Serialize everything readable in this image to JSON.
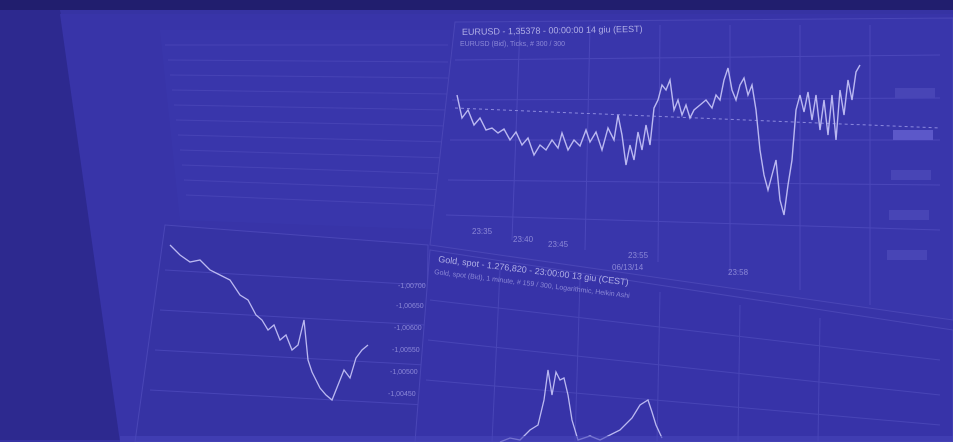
{
  "colors": {
    "overlay": "#3b38b0",
    "screen": "#3633a4",
    "bezel": "#1f1c6e",
    "line": "#d6d5ff",
    "grid": "#5552c0",
    "text": "#c9c8f2"
  },
  "chart_main": {
    "title": "EURUSD - 1,35378 - 00:00:00 14 giu (EEST)",
    "subtitle": "EURUSD (Bid), Ticks, # 300 / 300",
    "x_ticks": [
      "23:35",
      "23:40",
      "23:45",
      "23:55",
      "06/13/14",
      "23:58"
    ]
  },
  "chart_gold": {
    "title": "Gold, spot - 1.276,820 - 23:00:00 13 giu (CEST)",
    "subtitle": "Gold, spot (Bid), 1 minute, # 159 / 300, Logarithmic, Heikin Ashi"
  },
  "chart_left": {
    "y_ticks": [
      "-1,00700",
      "-1,00650",
      "-1,00600",
      "-1,00550",
      "-1,00500",
      "-1,00450"
    ]
  }
}
